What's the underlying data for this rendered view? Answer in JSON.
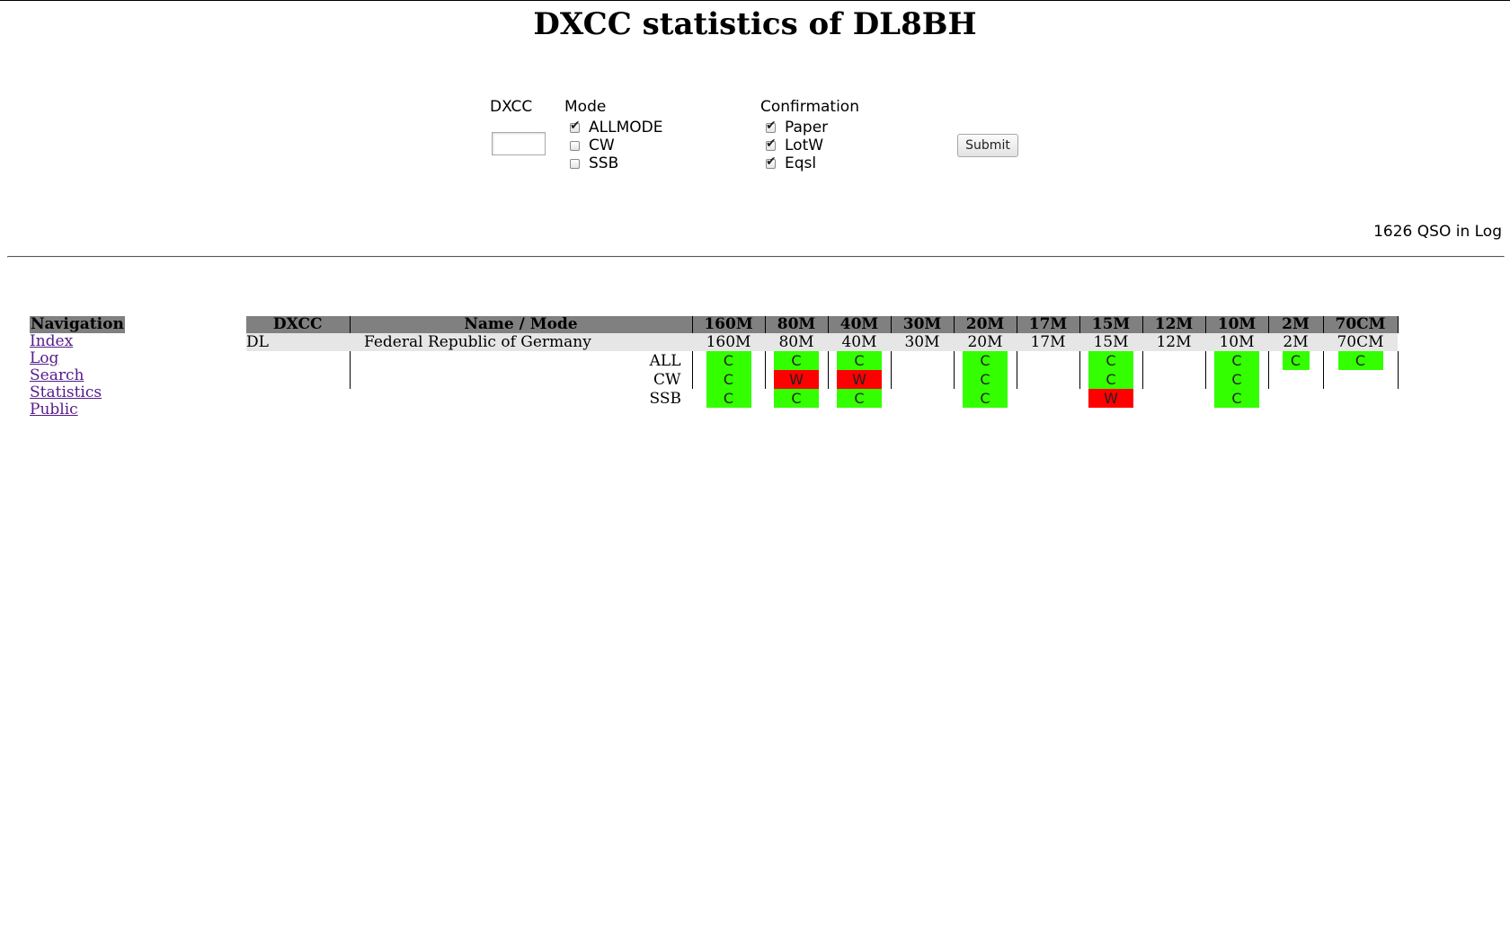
{
  "page": {
    "title": "DXCC statistics of DL8BH"
  },
  "form": {
    "dxcc_label": "DXCC",
    "dxcc_value": "",
    "mode_label": "Mode",
    "modes": [
      {
        "label": "ALLMODE",
        "checked": true
      },
      {
        "label": "CW",
        "checked": false
      },
      {
        "label": "SSB",
        "checked": false
      }
    ],
    "confirmation_label": "Confirmation",
    "confirmations": [
      {
        "label": "Paper",
        "checked": true
      },
      {
        "label": "LotW",
        "checked": true
      },
      {
        "label": "Eqsl",
        "checked": true
      }
    ],
    "submit_label": "Submit"
  },
  "qso_count": "1626 QSO in Log",
  "navigation": {
    "title": "Navigation",
    "links": [
      "Index",
      "Log",
      "Search",
      "Statistics",
      "Public"
    ]
  },
  "table": {
    "headers": [
      "DXCC",
      "Name / Mode",
      "160M",
      "80M",
      "40M",
      "30M",
      "20M",
      "17M",
      "15M",
      "12M",
      "10M",
      "2M",
      "70CM"
    ],
    "entity": {
      "prefix": "DL",
      "name": "Federal Republic of Germany",
      "bands": [
        "160M",
        "80M",
        "40M",
        "30M",
        "20M",
        "17M",
        "15M",
        "12M",
        "10M",
        "2M",
        "70CM"
      ]
    },
    "rows": [
      {
        "mode": "ALL",
        "cells": [
          "C",
          "C",
          "C",
          "",
          "C",
          "",
          "C",
          "",
          "C",
          "C",
          "C"
        ]
      },
      {
        "mode": "CW",
        "cells": [
          "C",
          "W",
          "W",
          "",
          "C",
          "",
          "C",
          "",
          "C",
          "",
          ""
        ]
      },
      {
        "mode": "SSB",
        "cells": [
          "C",
          "C",
          "C",
          "",
          "C",
          "",
          "W",
          "",
          "C",
          "",
          ""
        ]
      }
    ]
  },
  "colors": {
    "confirmed": "#33ff00",
    "worked": "#ff0000",
    "header_bg": "#808080",
    "entity_bg": "#e6e6e6"
  }
}
